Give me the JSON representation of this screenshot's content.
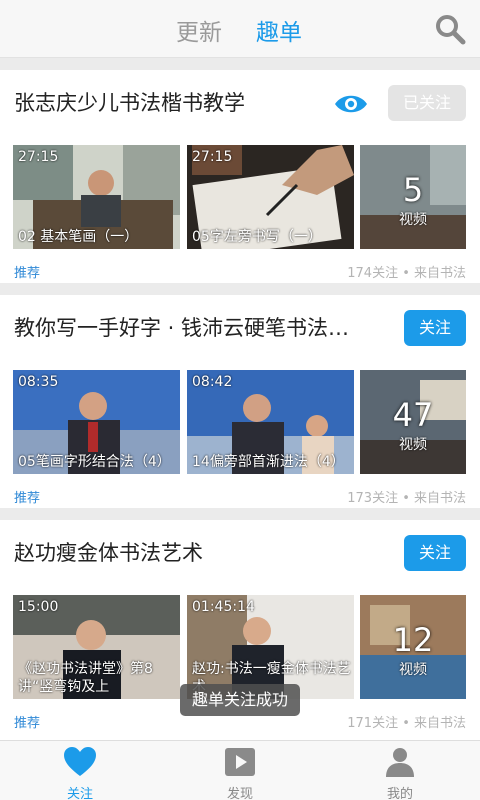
{
  "header": {
    "tabs": [
      {
        "label": "更新"
      },
      {
        "label": "趣单"
      }
    ],
    "active_tab": "趣单",
    "search_icon": "search-icon"
  },
  "colors": {
    "accent": "#1c9be9",
    "tag": "#2e88d6",
    "muted": "#b4b4b4"
  },
  "cards": [
    {
      "title": "张志庆少儿书法楷书教学",
      "follow_label": "已关注",
      "followed": true,
      "videos": [
        {
          "time": "27:15",
          "caption": "02 基本笔画（一）"
        },
        {
          "time": "27:15",
          "caption": "05字左旁书写（一）"
        }
      ],
      "video_count": "5",
      "video_unit": "视频",
      "tag": "推荐",
      "meta": "174关注 • 来自书法"
    },
    {
      "title": "教你写一手好字 · 钱沛云硬笔书法…",
      "follow_label": "关注",
      "followed": false,
      "videos": [
        {
          "time": "08:35",
          "caption": "05笔画字形结合法（4）"
        },
        {
          "time": "08:42",
          "caption": "14偏旁部首渐进法（4）"
        }
      ],
      "video_count": "47",
      "video_unit": "视频",
      "tag": "推荐",
      "meta": "173关注 • 来自书法"
    },
    {
      "title": "赵功瘦金体书法艺术",
      "follow_label": "关注",
      "followed": false,
      "videos": [
        {
          "time": "15:00",
          "caption": "《赵功书法讲堂》第8讲“竖弯钩及上"
        },
        {
          "time": "01:45:14",
          "caption": "赵功:书法一瘦金体书法艺术"
        }
      ],
      "video_count": "12",
      "video_unit": "视频",
      "tag": "推荐",
      "meta": "171关注 • 来自书法"
    }
  ],
  "toast": "趣单关注成功",
  "bottom_nav": [
    {
      "label": "关注",
      "icon": "heart-icon",
      "active": true
    },
    {
      "label": "发现",
      "icon": "play-icon",
      "active": false
    },
    {
      "label": "我的",
      "icon": "person-icon",
      "active": false
    }
  ]
}
